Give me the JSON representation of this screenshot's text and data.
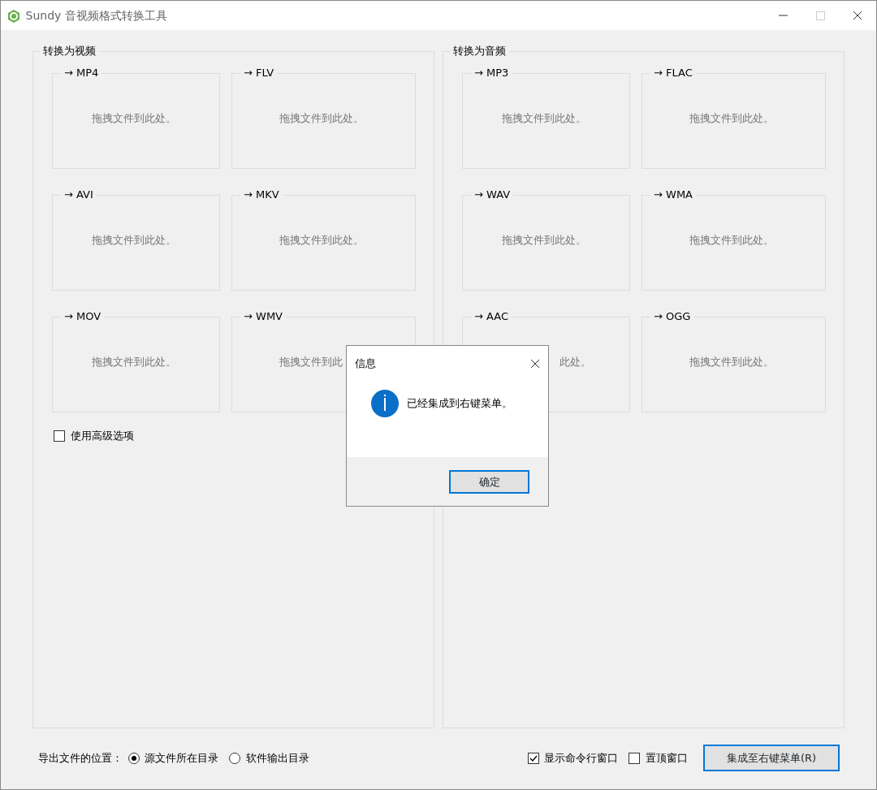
{
  "window": {
    "title": "Sundy 音视频格式转换工具",
    "maximize_disabled": true
  },
  "groups": [
    {
      "title": "转换为视频",
      "targets": [
        {
          "label": "→ MP4",
          "hint": "拖拽文件到此处。"
        },
        {
          "label": "→ FLV",
          "hint": "拖拽文件到此处。"
        },
        {
          "label": "→ AVI",
          "hint": "拖拽文件到此处。"
        },
        {
          "label": "→ MKV",
          "hint": "拖拽文件到此处。"
        },
        {
          "label": "→ MOV",
          "hint": "拖拽文件到此处。"
        },
        {
          "label": "→ WMV",
          "hint": "拖拽文件到此"
        }
      ],
      "option": {
        "label": "使用高级选项",
        "checked": false
      }
    },
    {
      "title": "转换为音频",
      "targets": [
        {
          "label": "→ MP3",
          "hint": "拖拽文件到此处。"
        },
        {
          "label": "→ FLAC",
          "hint": "拖拽文件到此处。"
        },
        {
          "label": "→ WAV",
          "hint": "拖拽文件到此处。"
        },
        {
          "label": "→ WMA",
          "hint": "拖拽文件到此处。"
        },
        {
          "label": "→ AAC",
          "hint": "此处。",
          "clipped_start": true
        },
        {
          "label": "→ OGG",
          "hint": "拖拽文件到此处。"
        }
      ]
    }
  ],
  "output": {
    "label": "导出文件的位置：",
    "choices": [
      {
        "label": "源文件所在目录",
        "selected": true
      },
      {
        "label": "软件输出目录",
        "selected": false
      }
    ]
  },
  "options": [
    {
      "label": "显示命令行窗口",
      "checked": true
    },
    {
      "label": "置顶窗口",
      "checked": false
    }
  ],
  "action_button": "集成至右键菜单(R)",
  "dialog": {
    "title": "信息",
    "message": "已经集成到右键菜单。",
    "button": "确定"
  }
}
